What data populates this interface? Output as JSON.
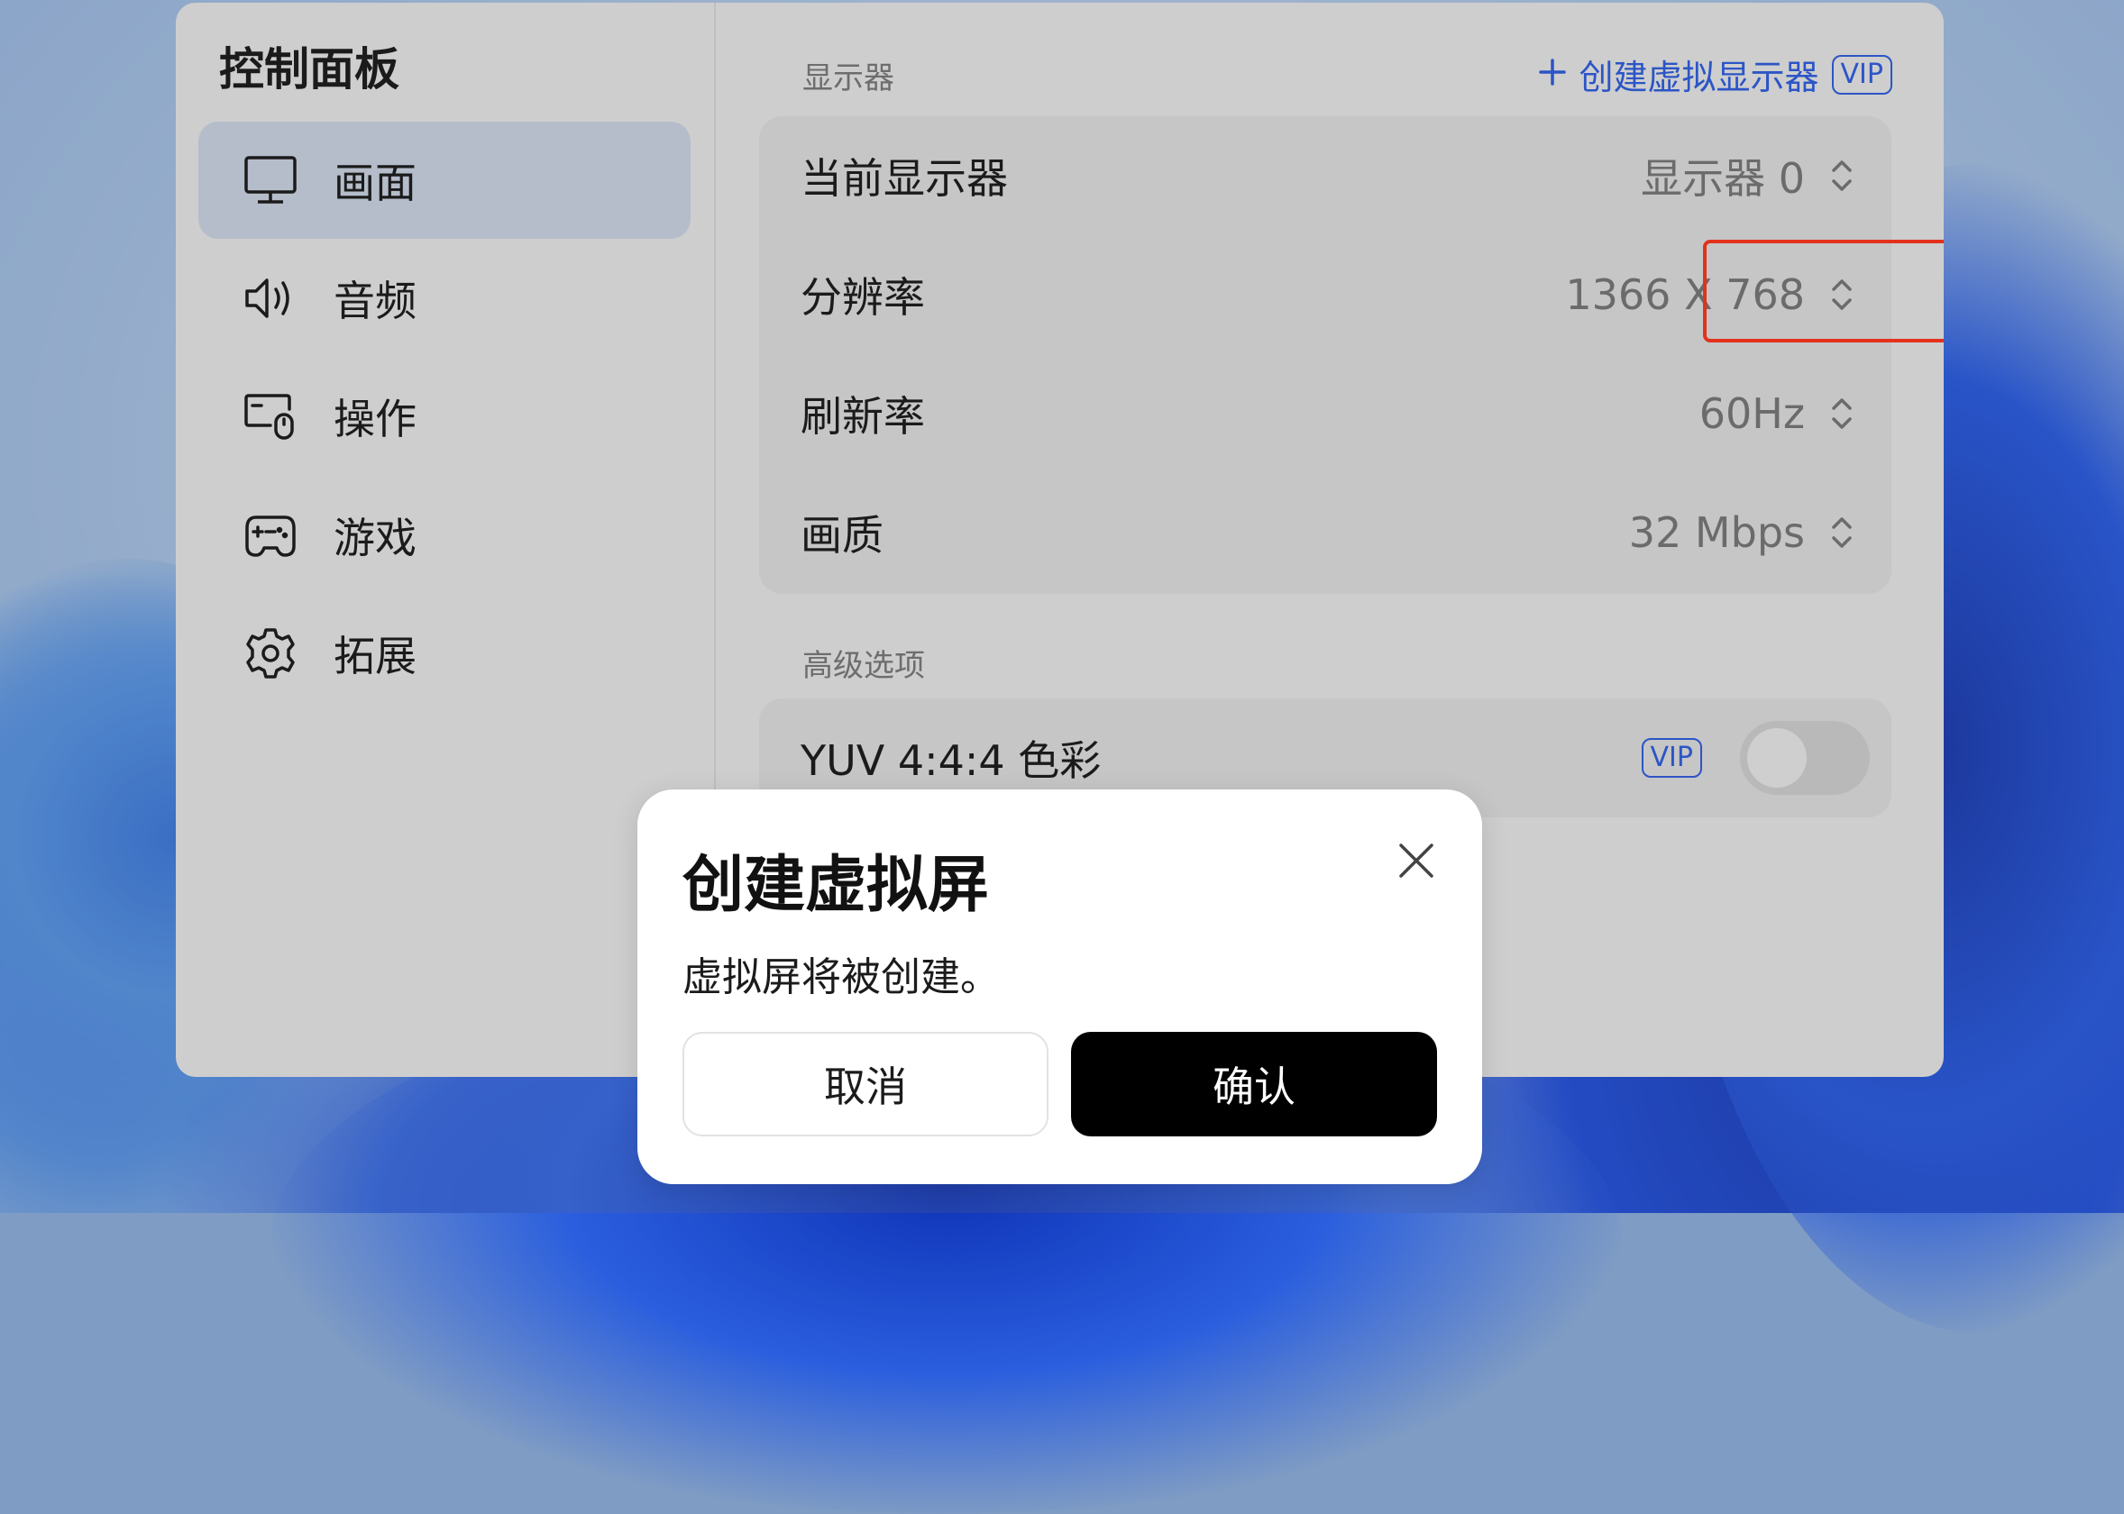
{
  "sidebar": {
    "title": "控制面板",
    "items": [
      {
        "label": "画面",
        "icon": "monitor-icon",
        "active": true
      },
      {
        "label": "音频",
        "icon": "speaker-icon",
        "active": false
      },
      {
        "label": "操作",
        "icon": "mouse-keyboard-icon",
        "active": false
      },
      {
        "label": "游戏",
        "icon": "gamepad-icon",
        "active": false
      },
      {
        "label": "拓展",
        "icon": "gear-icon",
        "active": false
      }
    ]
  },
  "display": {
    "section_label": "显示器",
    "create_virtual_label": "创建虚拟显示器",
    "vip_label": "VIP",
    "rows": [
      {
        "label": "当前显示器",
        "value": "显示器 0"
      },
      {
        "label": "分辨率",
        "value": "1366 X 768"
      },
      {
        "label": "刷新率",
        "value": "60Hz"
      },
      {
        "label": "画质",
        "value": "32 Mbps"
      }
    ]
  },
  "advanced": {
    "section_label": "高级选项",
    "yuv_label": "YUV 4:4:4 色彩",
    "vip_label": "VIP",
    "yuv_enabled": false
  },
  "dialog": {
    "title": "创建虚拟屏",
    "message": "虚拟屏将被创建。",
    "cancel_label": "取消",
    "confirm_label": "确认"
  },
  "colors": {
    "accent": "#2c55c6",
    "highlight": "#e3321c",
    "confirm_bg": "#000000"
  }
}
